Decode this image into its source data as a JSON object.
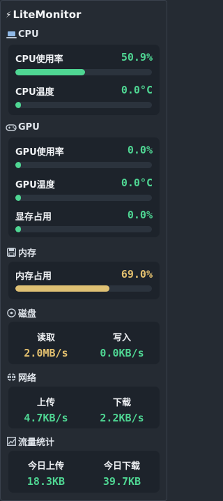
{
  "app": {
    "title": "LiteMonitor"
  },
  "colors": {
    "background": "#252b33",
    "card": "#1d232b",
    "accent_green": "#4fd693",
    "accent_yellow": "#dfc174",
    "track": "#2b333d"
  },
  "cpu": {
    "title": "CPU",
    "icon": "laptop-icon",
    "usage_label": "CPU使用率",
    "usage_value": "50.9%",
    "usage_percent": 50.9,
    "temp_label": "CPU温度",
    "temp_value": "0.0°C",
    "temp_percent": 0
  },
  "gpu": {
    "title": "GPU",
    "icon": "gamepad-icon",
    "usage_label": "GPU使用率",
    "usage_value": "0.0%",
    "usage_percent": 0,
    "temp_label": "GPU温度",
    "temp_value": "0.0°C",
    "temp_percent": 0,
    "vram_label": "显存占用",
    "vram_value": "0.0%",
    "vram_percent": 0
  },
  "memory": {
    "title": "内存",
    "icon": "floppy-disk-icon",
    "usage_label": "内存占用",
    "usage_value": "69.0%",
    "usage_percent": 69
  },
  "disk": {
    "title": "磁盘",
    "icon": "disk-icon",
    "read_label": "读取",
    "read_value": "2.0MB/s",
    "write_label": "写入",
    "write_value": "0.0KB/s"
  },
  "network": {
    "title": "网络",
    "icon": "globe-icon",
    "up_label": "上传",
    "up_value": "4.7KB/s",
    "down_label": "下载",
    "down_value": "2.2KB/s"
  },
  "traffic": {
    "title": "流量统计",
    "icon": "chart-icon",
    "today_up_label": "今日上传",
    "today_up_value": "18.3KB",
    "today_down_label": "今日下载",
    "today_down_value": "39.7KB"
  }
}
